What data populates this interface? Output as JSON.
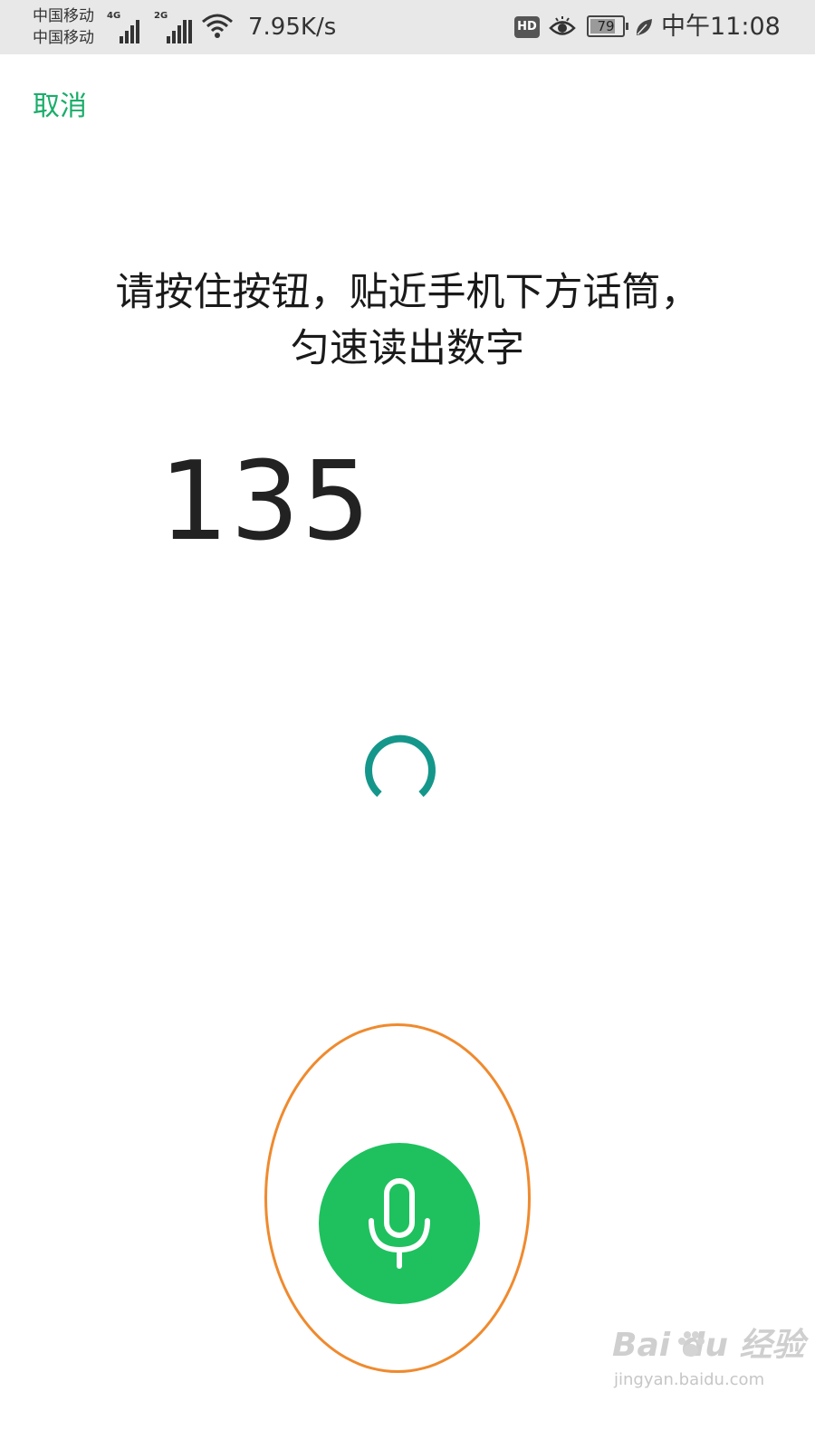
{
  "status_bar": {
    "carrier_1": "中国移动",
    "carrier_2": "中国移动",
    "signal_1_type": "4G",
    "signal_2_type": "2G",
    "wifi_icon": "wifi-icon",
    "net_speed": "7.95K/s",
    "hd_badge": "HD",
    "eye_icon": "eye-icon",
    "battery_level": "79",
    "battery_fraction": 0.79,
    "power_save_icon": "leaf-icon",
    "time": "中午11:08"
  },
  "header": {
    "cancel_label": "取消"
  },
  "prompt": {
    "line_1": "请按住按钮，贴近手机下方话筒，",
    "line_2": "匀速读出数字"
  },
  "digits": {
    "shown": "135"
  },
  "loading": {
    "icon": "loading-spinner-icon"
  },
  "mic": {
    "icon": "microphone-icon"
  },
  "colors": {
    "accent_green": "#1ec15e",
    "link_green": "#1aad6a",
    "spinner_teal": "#14978a",
    "highlight_orange": "#ef8a2e"
  },
  "watermark": {
    "brand_text": "Bai du 经验",
    "url": "jingyan.baidu.com"
  }
}
